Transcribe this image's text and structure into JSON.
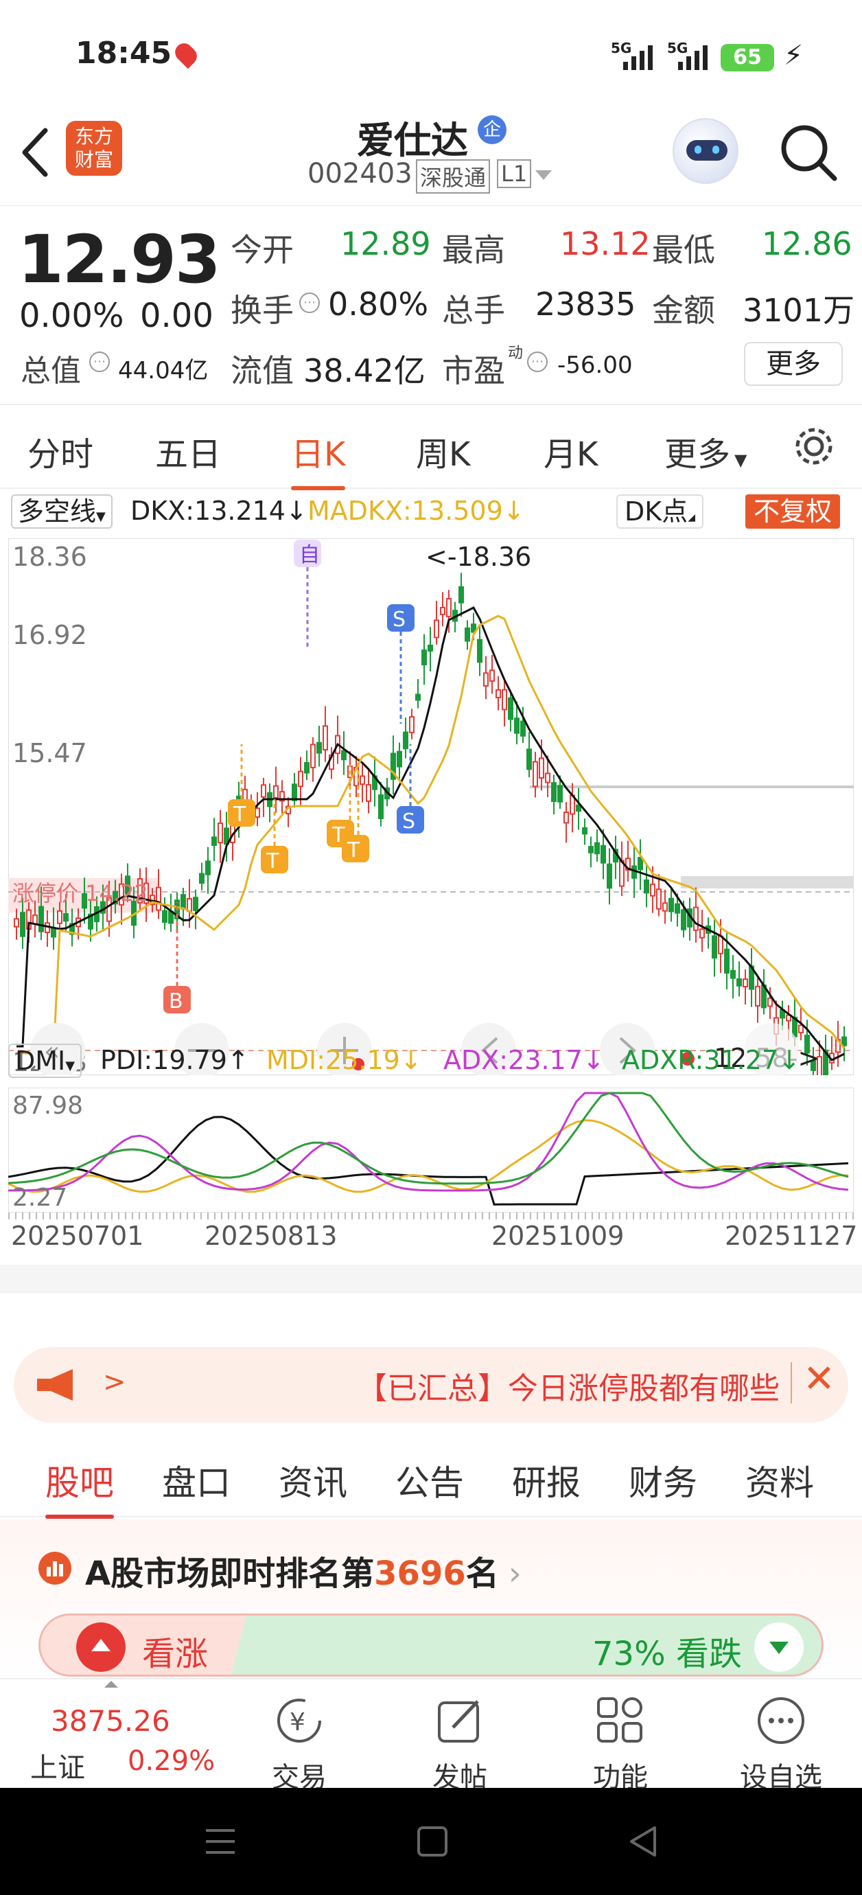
{
  "status": {
    "time": "18:45",
    "battery": "65",
    "signal1": "5G",
    "signal2": "5G"
  },
  "header": {
    "title": "爱仕达",
    "badge": "企",
    "code": "002403",
    "market": "深股通",
    "level": "L1",
    "logo_line1": "东方",
    "logo_line2": "财富"
  },
  "quote": {
    "price": "12.93",
    "change_pct": "0.00%",
    "change": "0.00",
    "open_label": "今开",
    "open": "12.89",
    "high_label": "最高",
    "high": "13.12",
    "low_label": "最低",
    "low": "12.86",
    "turnover_label": "换手",
    "turnover": "0.80%",
    "volume_label": "总手",
    "volume": "23835",
    "amount_label": "金额",
    "amount": "3101万",
    "mktcap_label": "总值",
    "mktcap": "44.04亿",
    "float_label": "流值",
    "float": "38.42亿",
    "pe_label": "市盈",
    "pe_sup": "动",
    "pe": "-56.00",
    "more": "更多"
  },
  "tabs": [
    {
      "label": "分时"
    },
    {
      "label": "五日"
    },
    {
      "label": "日K"
    },
    {
      "label": "周K"
    },
    {
      "label": "月K"
    },
    {
      "label": "更多"
    }
  ],
  "chart": {
    "indicator_select": "多空线",
    "dkx": "DKX:13.214↓",
    "madkx": "MADKX:13.509↓",
    "dk_btn": "DK点",
    "fq_btn": "不复权",
    "ylabels": [
      "18.36",
      "16.92",
      "15.47",
      "12.58"
    ],
    "limit_label": "涨停价 14.22",
    "max_label": "<-18.36",
    "min_label": "12.58->",
    "markers": {
      "zi": "自",
      "b": "B",
      "s": "S",
      "t": "T"
    },
    "colors": {
      "up": "#e53935",
      "down": "#1a9a3a",
      "dkx": "#111111",
      "madkx": "#e6b422"
    }
  },
  "dmi": {
    "select": "DMI",
    "pdi": "PDI:19.79↑",
    "mdi": "MDI:25.19↓",
    "adx": "ADX:23.17↓",
    "adxr": "ADXR:31.27↓",
    "ymax": "87.98",
    "ymin": "2.27",
    "dates": [
      "20250701",
      "20250813",
      "20251009",
      "20251127"
    ]
  },
  "news": {
    "text": "【已汇总】今日涨停股都有哪些"
  },
  "subtabs": [
    {
      "label": "股吧"
    },
    {
      "label": "盘口"
    },
    {
      "label": "资讯"
    },
    {
      "label": "公告"
    },
    {
      "label": "研报"
    },
    {
      "label": "财务"
    },
    {
      "label": "资料"
    }
  ],
  "rank": {
    "prefix": "A股市场即时排名第",
    "num": "3696",
    "suffix": "名",
    "bull_label": "看涨",
    "bear_text": "73% 看跌"
  },
  "bottom": {
    "index_value": "3875.26",
    "index_name": "上证",
    "index_pct": "0.29%",
    "items": [
      {
        "label": "交易"
      },
      {
        "label": "发帖"
      },
      {
        "label": "功能"
      },
      {
        "label": "设自选"
      }
    ]
  }
}
